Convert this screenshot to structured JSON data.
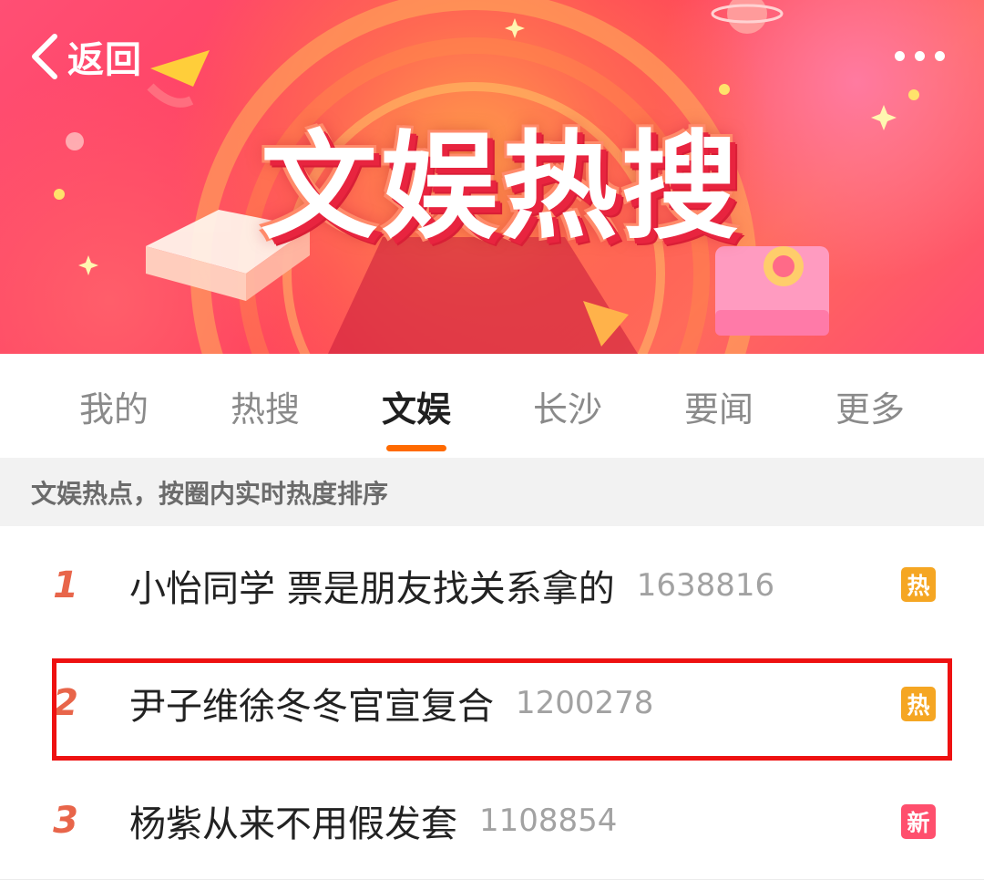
{
  "header": {
    "back_label": "返回",
    "banner_title": "文娱热搜"
  },
  "tabs": [
    {
      "label": "我的",
      "active": false
    },
    {
      "label": "热搜",
      "active": false
    },
    {
      "label": "文娱",
      "active": true
    },
    {
      "label": "长沙",
      "active": false
    },
    {
      "label": "要闻",
      "active": false
    },
    {
      "label": "更多",
      "active": false
    }
  ],
  "section_note": "文娱热点，按圈内实时热度排序",
  "hot_list": [
    {
      "rank": "1",
      "title": "小怡同学 票是朋友找关系拿的",
      "count": "1638816",
      "badge": "热",
      "badge_color": "#f5a623"
    },
    {
      "rank": "2",
      "title": "尹子维徐冬冬官宣复合",
      "count": "1200278",
      "badge": "热",
      "badge_color": "#f5a623"
    },
    {
      "rank": "3",
      "title": "杨紫从来不用假发套",
      "count": "1108854",
      "badge": "新",
      "badge_color": "#ff4f6d"
    }
  ],
  "colors": {
    "accent": "#ff6a00",
    "rank": "#e8654a",
    "highlight": "#ee1111"
  }
}
